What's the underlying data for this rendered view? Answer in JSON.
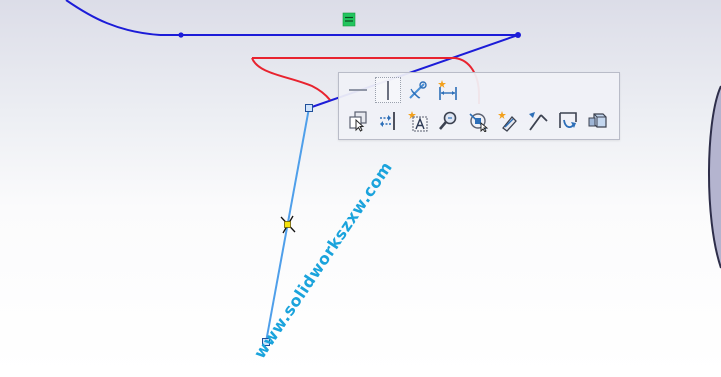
{
  "watermark": {
    "text": "www.solidworkszxw.com"
  },
  "colors": {
    "sketch_line": "#1c1cd8",
    "selected_line": "#4f9fea",
    "markup_pen": "#e8232f",
    "relation_badge": "#22c55e",
    "handle_midpoint": "#f4e20b",
    "watermark": "#1aa3dc",
    "toolbar_bg": "#f0f1f6"
  },
  "context_toolbar": {
    "row1": [
      {
        "icon": "horizontal-relation-icon"
      },
      {
        "icon": "vertical-relation-icon",
        "active": true
      },
      {
        "icon": "fix-relation-icon"
      },
      {
        "icon": "smart-dimension-icon"
      }
    ],
    "row2": [
      {
        "icon": "display-delete-relations-icon"
      },
      {
        "icon": "convert-construction-icon"
      },
      {
        "icon": "smart-dimension-text-icon"
      },
      {
        "icon": "zoom-to-selection-icon"
      },
      {
        "icon": "select-chain-icon"
      },
      {
        "icon": "edit-sketch-icon"
      },
      {
        "icon": "normal-to-icon"
      },
      {
        "icon": "rebuild-icon"
      },
      {
        "icon": "view-orientation-icon"
      }
    ]
  }
}
